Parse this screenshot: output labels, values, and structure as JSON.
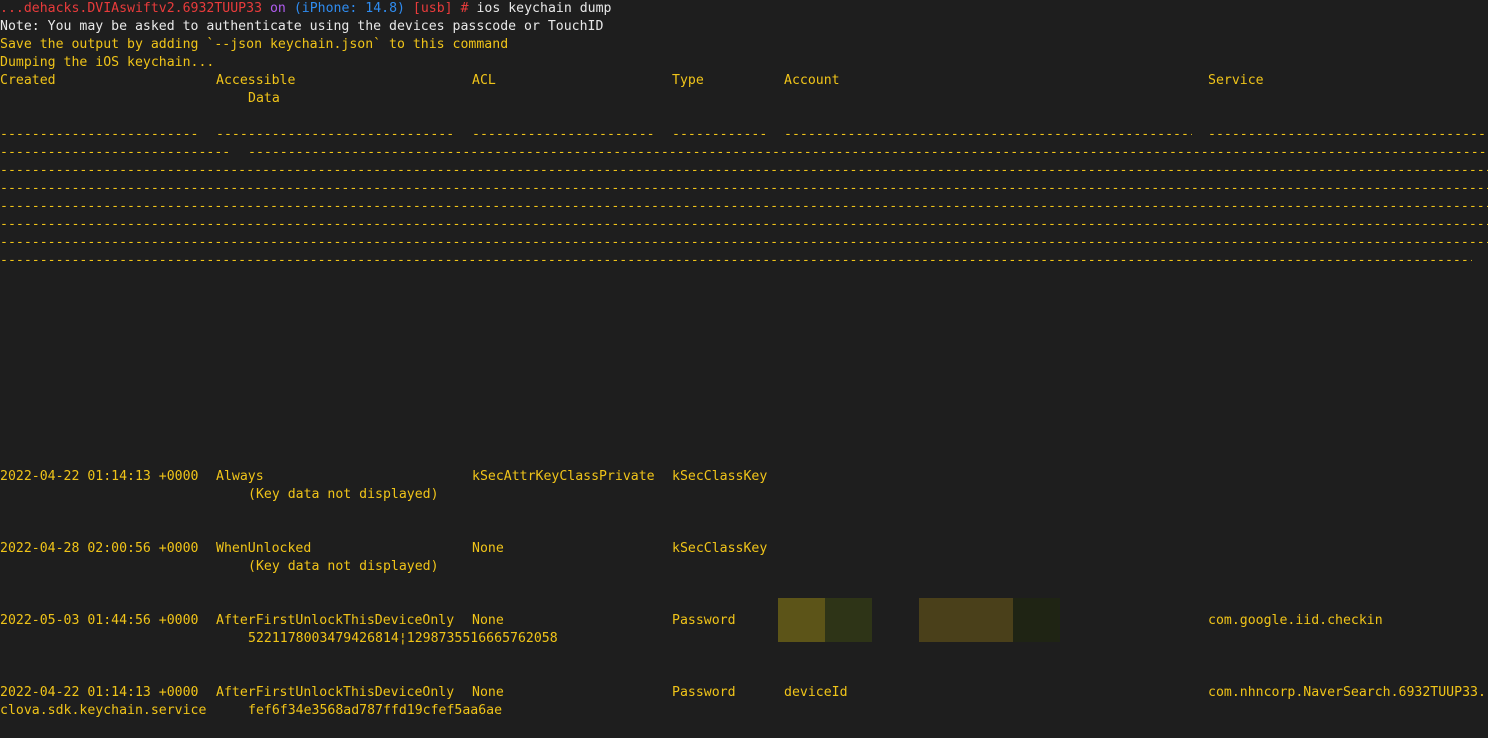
{
  "prompt": {
    "app": "...dehacks.DVIAswiftv2.6932TUUP33",
    "on": "on",
    "device": "(iPhone: 14.8)",
    "transport": "[usb]",
    "symbol": "#",
    "command": "ios keychain dump"
  },
  "messages": {
    "note": "Note: You may be asked to authenticate using the devices passcode or TouchID",
    "save": "Save the output by adding `--json keychain.json` to this command",
    "dumping": "Dumping the iOS keychain..."
  },
  "table": {
    "headers": {
      "created": "Created",
      "accessible": "Accessible",
      "acl": "ACL",
      "type": "Type",
      "account": "Account",
      "service": "Service",
      "data": "Data"
    },
    "rows": [
      {
        "created": "2022-04-22 01:14:13 +0000",
        "accessible": "Always",
        "acl": "kSecAttrKeyClassPrivate",
        "type": "kSecClassKey",
        "account": "",
        "service": "",
        "service_cont": "",
        "data": "(Key data not displayed)"
      },
      {
        "created": "2022-04-28 02:00:56 +0000",
        "accessible": "WhenUnlocked",
        "acl": "None",
        "type": "kSecClassKey",
        "account": "",
        "service": "",
        "service_cont": "",
        "data": "(Key data not displayed)"
      },
      {
        "created": "2022-05-03 01:44:56 +0000",
        "accessible": "AfterFirstUnlockThisDeviceOnly",
        "acl": "None",
        "type": "Password",
        "account": "",
        "service": "com.google.iid.checkin",
        "service_cont": "",
        "data": "5221178003479426814¦1298735516665762058"
      },
      {
        "created": "2022-04-22 01:14:13 +0000",
        "accessible": "AfterFirstUnlockThisDeviceOnly",
        "acl": "None",
        "type": "Password",
        "account": "deviceId",
        "service": "com.nhncorp.NaverSearch.6932TUUP33.",
        "service_cont": "clova.sdk.keychain.service",
        "data": "fef6f34e3568ad787ffd19cfef5aa6ae"
      }
    ]
  },
  "colors": {
    "background": "#1e1e1e",
    "text": "#f0c419",
    "prompt_red": "#e83b3b",
    "prompt_purple": "#b05cf0",
    "prompt_blue": "#2f8cf0",
    "redaction_1": "#5c5418",
    "redaction_2": "#2e3417",
    "redaction_3": "#4a401a",
    "redaction_4": "#1f2414"
  }
}
